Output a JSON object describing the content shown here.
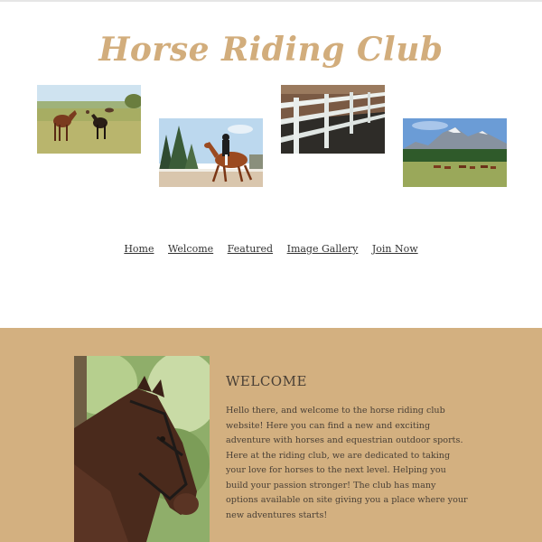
{
  "site": {
    "title": "Horse Riding Club"
  },
  "gallery": [
    {
      "name": "horses-grazing-photo"
    },
    {
      "name": "dressage-rider-photo"
    },
    {
      "name": "fence-paddock-photo"
    },
    {
      "name": "mountain-herd-photo"
    }
  ],
  "nav": {
    "items": [
      {
        "label": "Home"
      },
      {
        "label": "Welcome"
      },
      {
        "label": "Featured"
      },
      {
        "label": "Image Gallery"
      },
      {
        "label": "Join Now"
      }
    ]
  },
  "welcome": {
    "heading": "WELCOME",
    "body": "Hello there, and welcome to the horse riding club website! Here you can find a new and exciting adventure with horses and equestrian outdoor sports. Here at the riding club, we are dedicated to taking your love for horses to the next level. Helping you build your passion stronger! The club has many options available on site giving you a place where your new adventures starts!"
  },
  "colors": {
    "accent": "#d2ad7c",
    "band": "#d3b080",
    "text": "#4a4036"
  }
}
